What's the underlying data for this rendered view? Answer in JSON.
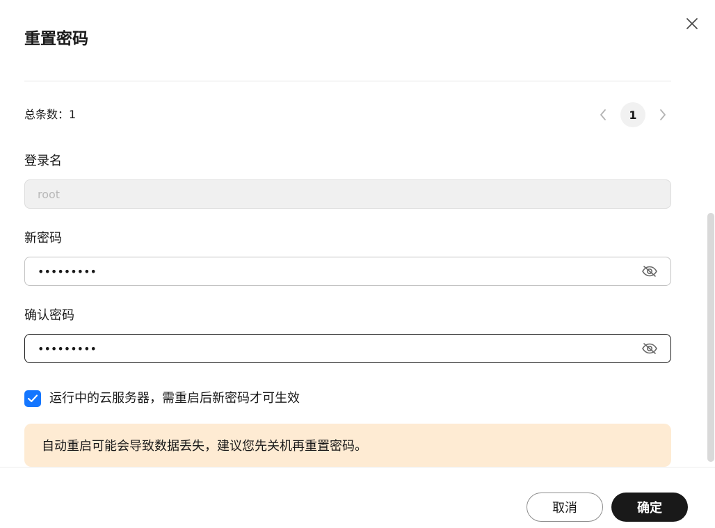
{
  "dialog": {
    "title": "重置密码",
    "close_icon": "close-icon"
  },
  "summary": {
    "total_text": "总条数：1"
  },
  "pagination": {
    "prev_icon": "chevron-left-icon",
    "current_page": "1",
    "next_icon": "chevron-right-icon"
  },
  "form": {
    "login_name": {
      "label": "登录名",
      "value": "root",
      "disabled": true
    },
    "new_password": {
      "label": "新密码",
      "value": "•••••••••",
      "toggle_icon": "eye-off-icon"
    },
    "confirm_password": {
      "label": "确认密码",
      "value": "•••••••••",
      "toggle_icon": "eye-off-icon"
    }
  },
  "restart_option": {
    "checked": true,
    "label": "运行中的云服务器，需重启后新密码才可生效"
  },
  "warning": {
    "text": "自动重启可能会导致数据丢失，建议您先关机再重置密码。"
  },
  "footer": {
    "cancel_label": "取消",
    "confirm_label": "确定"
  },
  "colors": {
    "accent": "#1476ff",
    "primary_button": "#191919",
    "warning_bg": "#feebd3",
    "disabled_bg": "#f0f0f0"
  }
}
